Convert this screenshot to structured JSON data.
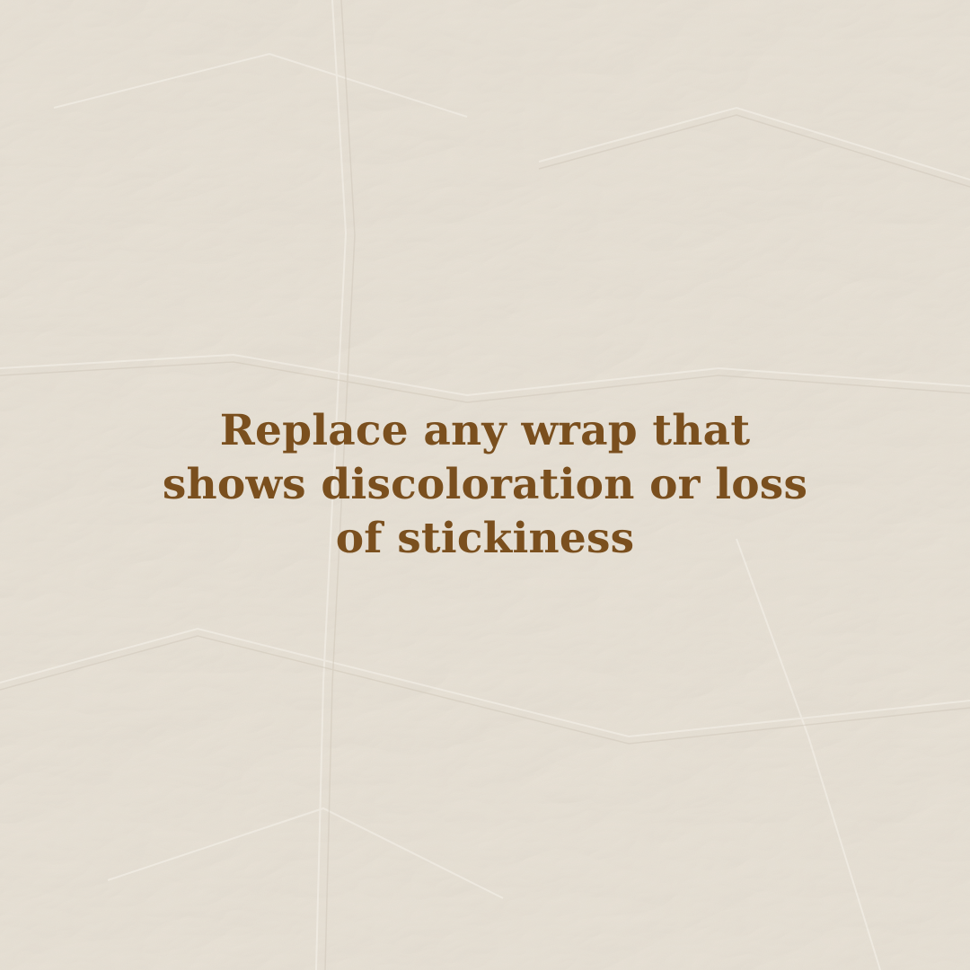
{
  "background": {
    "texture": "crumpled-paper",
    "base_color": "#e9e2d6"
  },
  "message": {
    "lines": [
      "Replace any wrap that",
      "shows discoloration or loss",
      "of stickiness"
    ],
    "color": "#7a4f1e"
  }
}
